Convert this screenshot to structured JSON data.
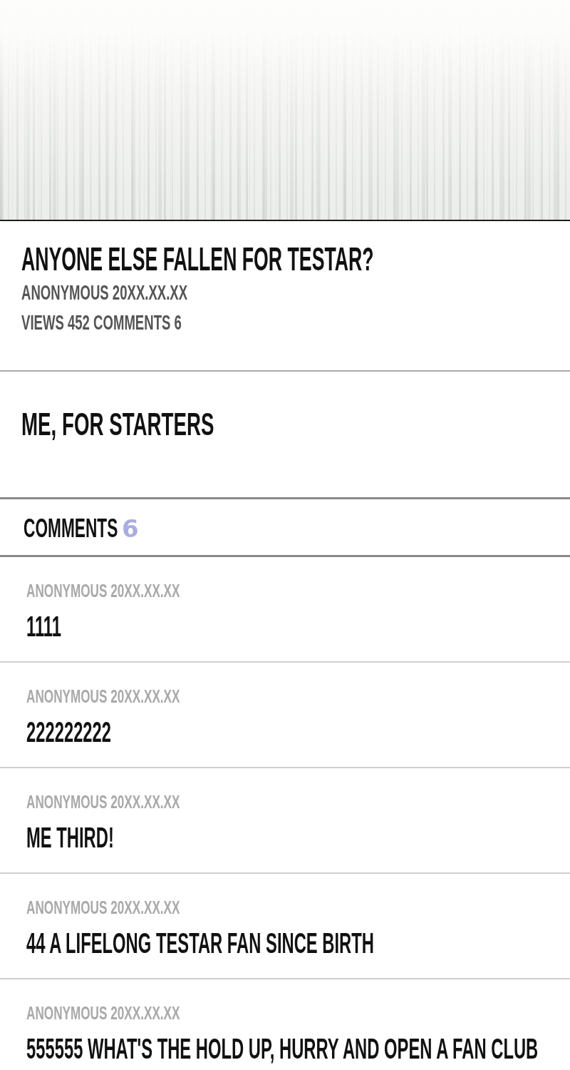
{
  "post": {
    "title": "ANYONE ELSE FALLEN FOR TESTAR?",
    "byline": "ANONYMOUS 20XX.XX.XX",
    "stats": "VIEWS 452 COMMENTS 6",
    "body": "ME, FOR STARTERS"
  },
  "comments_header": {
    "label": "COMMENTS",
    "count": "6"
  },
  "comments": [
    {
      "byline": "ANONYMOUS 20XX.XX.XX",
      "text": "1111"
    },
    {
      "byline": "ANONYMOUS 20XX.XX.XX",
      "text": "222222222"
    },
    {
      "byline": "ANONYMOUS 20XX.XX.XX",
      "text": "ME THIRD!"
    },
    {
      "byline": "ANONYMOUS 20XX.XX.XX",
      "text": "44 A LIFELONG TESTAR FAN SINCE BIRTH"
    },
    {
      "byline": "ANONYMOUS 20XX.XX.XX",
      "text": "555555 WHAT'S THE HOLD UP, HURRY AND OPEN A FAN CLUB"
    }
  ]
}
